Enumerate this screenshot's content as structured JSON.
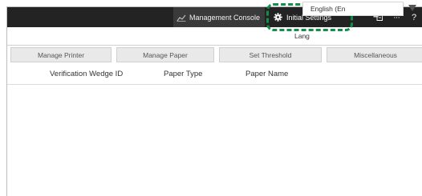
{
  "topbar": {
    "management_console_label": "Management Console",
    "initial_settings_label": "Initial Settings",
    "more_label": "···",
    "help_label": "?"
  },
  "language": {
    "label": "Lang",
    "value": "English (En"
  },
  "tabs": [
    {
      "label": "Manage Printer"
    },
    {
      "label": "Manage Paper"
    },
    {
      "label": "Set Threshold"
    },
    {
      "label": "Miscellaneous"
    }
  ],
  "table": {
    "columns": [
      "Verification Wedge ID",
      "Paper Type",
      "Paper Name"
    ],
    "rows": []
  },
  "colors": {
    "topbar": "#232323",
    "highlight": "#12904a",
    "tab_bg": "#e9e9e9"
  }
}
